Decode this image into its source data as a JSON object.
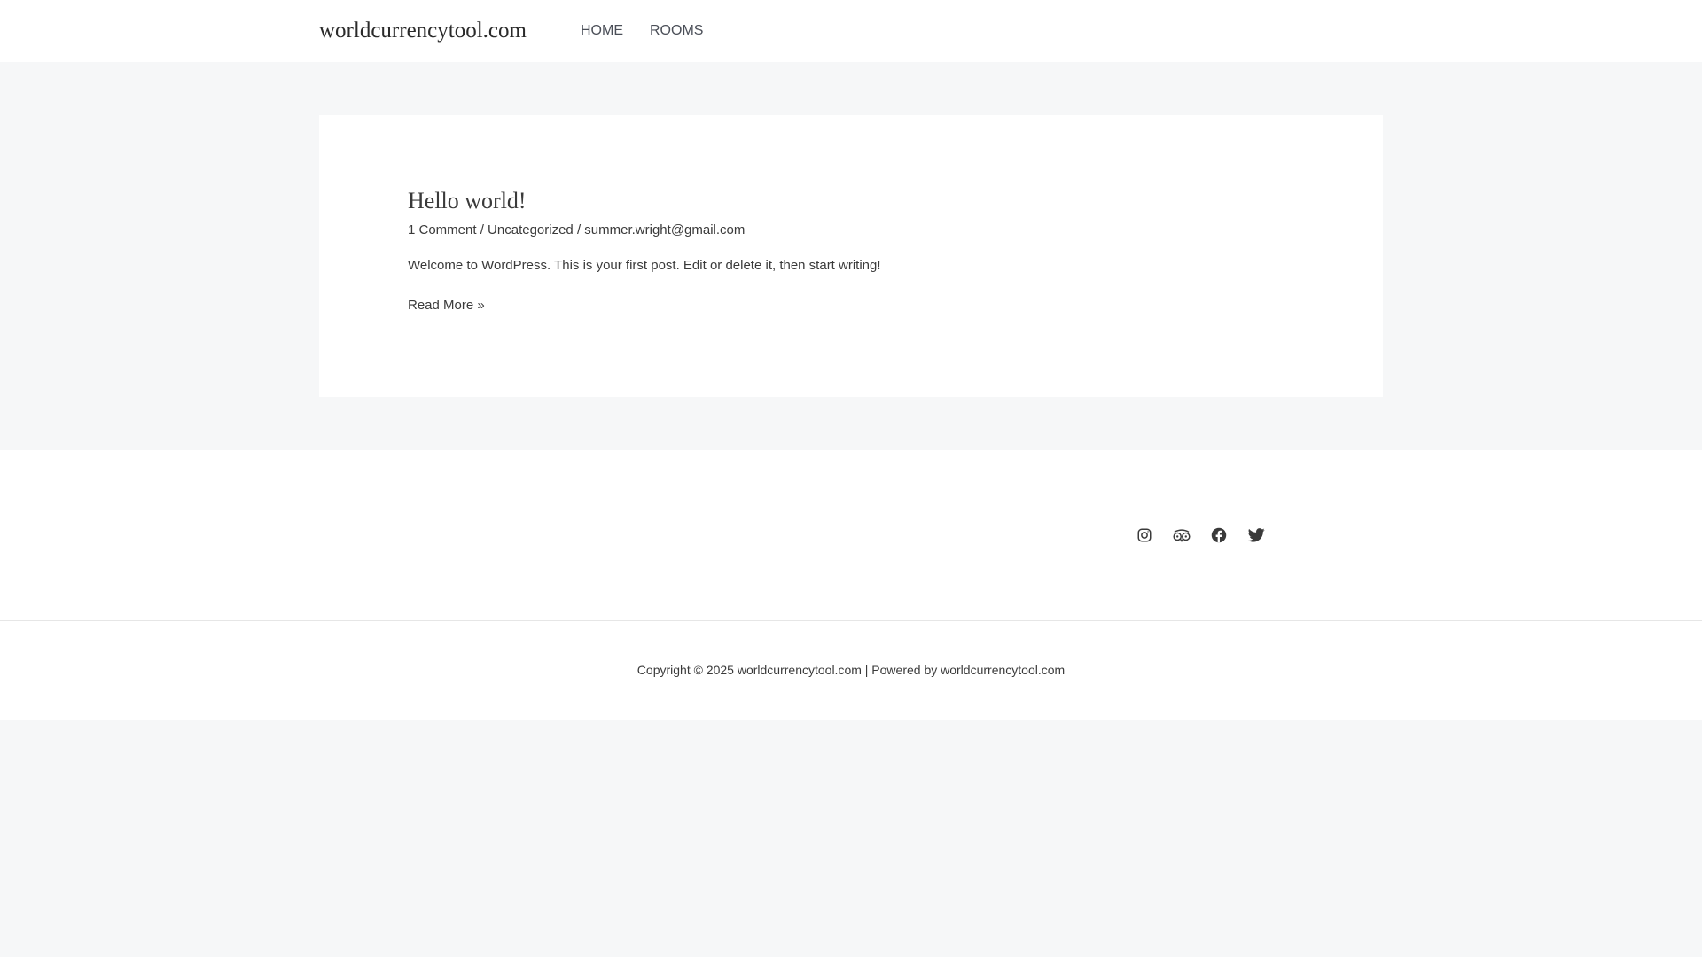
{
  "header": {
    "site_title": "worldcurrencytool.com",
    "nav": [
      {
        "label": "HOME"
      },
      {
        "label": "ROOMS"
      }
    ]
  },
  "post": {
    "title": "Hello world!",
    "meta": {
      "comments": "1 Comment",
      "separator1": " / ",
      "category": "Uncategorized",
      "separator2": " / ",
      "author": "summer.wright@gmail.com"
    },
    "excerpt": "Welcome to WordPress. This is your first post. Edit or delete it, then start writing!",
    "read_more": "Read More »"
  },
  "footer": {
    "social": [
      {
        "icon": "instagram-icon"
      },
      {
        "icon": "tripadvisor-icon"
      },
      {
        "icon": "facebook-icon"
      },
      {
        "icon": "twitter-icon"
      }
    ],
    "copyright": "Copyright © 2025 worldcurrencytool.com | Powered by worldcurrencytool.com"
  },
  "colors": {
    "page_background": "#f6f7f8",
    "surface": "#ffffff",
    "text": "#3a3a3a",
    "nav_text": "#4b4f58",
    "icon": "#3a3a3a"
  }
}
